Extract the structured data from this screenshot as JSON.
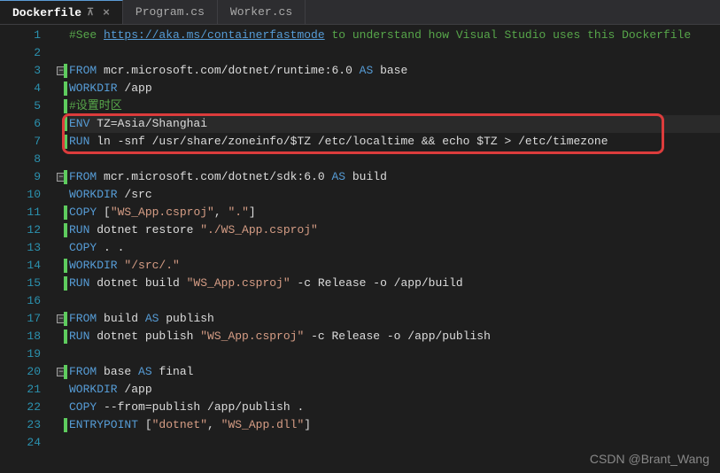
{
  "tabs": [
    {
      "label": "Dockerfile",
      "active": true,
      "pinned": true
    },
    {
      "label": "Program.cs",
      "active": false
    },
    {
      "label": "Worker.cs",
      "active": false
    }
  ],
  "lines": [
    {
      "n": 1,
      "fold": "",
      "marker": false,
      "tokens": [
        {
          "t": "#See ",
          "c": "c-comment"
        },
        {
          "t": "https://aka.ms/containerfastmode",
          "c": "c-link"
        },
        {
          "t": " to understand how Visual Studio uses this Dockerfile",
          "c": "c-comment"
        }
      ]
    },
    {
      "n": 2,
      "fold": "",
      "marker": false,
      "tokens": []
    },
    {
      "n": 3,
      "fold": "minus",
      "marker": true,
      "tokens": [
        {
          "t": "FROM",
          "c": "c-keyword"
        },
        {
          "t": " mcr.microsoft.com/dotnet/runtime:6.0 ",
          "c": "c-white"
        },
        {
          "t": "AS",
          "c": "c-as"
        },
        {
          "t": " base",
          "c": "c-white"
        }
      ]
    },
    {
      "n": 4,
      "fold": "",
      "marker": true,
      "tokens": [
        {
          "t": "WORKDIR",
          "c": "c-keyword"
        },
        {
          "t": " /app",
          "c": "c-white"
        }
      ]
    },
    {
      "n": 5,
      "fold": "",
      "marker": true,
      "tokens": [
        {
          "t": "#设置时区",
          "c": "c-comment"
        }
      ]
    },
    {
      "n": 6,
      "fold": "",
      "marker": true,
      "current": true,
      "tokens": [
        {
          "t": "ENV",
          "c": "c-keyword"
        },
        {
          "t": " TZ=Asia/Shanghai",
          "c": "c-white"
        }
      ]
    },
    {
      "n": 7,
      "fold": "",
      "marker": true,
      "tokens": [
        {
          "t": "RUN",
          "c": "c-keyword"
        },
        {
          "t": " ln -snf /usr/share/zoneinfo/$TZ /etc/localtime && echo $TZ > /etc/timezone",
          "c": "c-white"
        }
      ]
    },
    {
      "n": 8,
      "fold": "",
      "marker": false,
      "tokens": []
    },
    {
      "n": 9,
      "fold": "minus",
      "marker": true,
      "tokens": [
        {
          "t": "FROM",
          "c": "c-keyword"
        },
        {
          "t": " mcr.microsoft.com/dotnet/sdk:6.0 ",
          "c": "c-white"
        },
        {
          "t": "AS",
          "c": "c-as"
        },
        {
          "t": " build",
          "c": "c-white"
        }
      ]
    },
    {
      "n": 10,
      "fold": "",
      "marker": false,
      "tokens": [
        {
          "t": "WORKDIR",
          "c": "c-keyword"
        },
        {
          "t": " /src",
          "c": "c-white"
        }
      ]
    },
    {
      "n": 11,
      "fold": "",
      "marker": true,
      "tokens": [
        {
          "t": "COPY",
          "c": "c-keyword"
        },
        {
          "t": " [",
          "c": "c-white"
        },
        {
          "t": "\"WS_App.csproj\"",
          "c": "c-red"
        },
        {
          "t": ", ",
          "c": "c-white"
        },
        {
          "t": "\".\"",
          "c": "c-red"
        },
        {
          "t": "]",
          "c": "c-white"
        }
      ]
    },
    {
      "n": 12,
      "fold": "",
      "marker": true,
      "tokens": [
        {
          "t": "RUN",
          "c": "c-keyword"
        },
        {
          "t": " dotnet restore ",
          "c": "c-white"
        },
        {
          "t": "\"./WS_App.csproj\"",
          "c": "c-red"
        }
      ]
    },
    {
      "n": 13,
      "fold": "",
      "marker": false,
      "tokens": [
        {
          "t": "COPY",
          "c": "c-keyword"
        },
        {
          "t": " . .",
          "c": "c-white"
        }
      ]
    },
    {
      "n": 14,
      "fold": "",
      "marker": true,
      "tokens": [
        {
          "t": "WORKDIR",
          "c": "c-keyword"
        },
        {
          "t": " ",
          "c": "c-white"
        },
        {
          "t": "\"/src/.\"",
          "c": "c-red"
        }
      ]
    },
    {
      "n": 15,
      "fold": "",
      "marker": true,
      "tokens": [
        {
          "t": "RUN",
          "c": "c-keyword"
        },
        {
          "t": " dotnet build ",
          "c": "c-white"
        },
        {
          "t": "\"WS_App.csproj\"",
          "c": "c-red"
        },
        {
          "t": " -c Release -o /app/build",
          "c": "c-white"
        }
      ]
    },
    {
      "n": 16,
      "fold": "",
      "marker": false,
      "tokens": []
    },
    {
      "n": 17,
      "fold": "minus",
      "marker": true,
      "tokens": [
        {
          "t": "FROM",
          "c": "c-keyword"
        },
        {
          "t": " build ",
          "c": "c-white"
        },
        {
          "t": "AS",
          "c": "c-as"
        },
        {
          "t": " publish",
          "c": "c-white"
        }
      ]
    },
    {
      "n": 18,
      "fold": "",
      "marker": true,
      "tokens": [
        {
          "t": "RUN",
          "c": "c-keyword"
        },
        {
          "t": " dotnet publish ",
          "c": "c-white"
        },
        {
          "t": "\"WS_App.csproj\"",
          "c": "c-red"
        },
        {
          "t": " -c Release -o /app/publish",
          "c": "c-white"
        }
      ]
    },
    {
      "n": 19,
      "fold": "",
      "marker": false,
      "tokens": []
    },
    {
      "n": 20,
      "fold": "minus",
      "marker": true,
      "tokens": [
        {
          "t": "FROM",
          "c": "c-keyword"
        },
        {
          "t": " base ",
          "c": "c-white"
        },
        {
          "t": "AS",
          "c": "c-as"
        },
        {
          "t": " final",
          "c": "c-white"
        }
      ]
    },
    {
      "n": 21,
      "fold": "",
      "marker": false,
      "tokens": [
        {
          "t": "WORKDIR",
          "c": "c-keyword"
        },
        {
          "t": " /app",
          "c": "c-white"
        }
      ]
    },
    {
      "n": 22,
      "fold": "",
      "marker": false,
      "tokens": [
        {
          "t": "COPY",
          "c": "c-keyword"
        },
        {
          "t": " --from=publish /app/publish .",
          "c": "c-white"
        }
      ]
    },
    {
      "n": 23,
      "fold": "",
      "marker": true,
      "tokens": [
        {
          "t": "ENTRYPOINT",
          "c": "c-keyword"
        },
        {
          "t": " [",
          "c": "c-white"
        },
        {
          "t": "\"dotnet\"",
          "c": "c-red"
        },
        {
          "t": ", ",
          "c": "c-white"
        },
        {
          "t": "\"WS_App.dll\"",
          "c": "c-red"
        },
        {
          "t": "]",
          "c": "c-white"
        }
      ]
    },
    {
      "n": 24,
      "fold": "",
      "marker": false,
      "tokens": []
    }
  ],
  "watermark": "CSDN @Brant_Wang"
}
